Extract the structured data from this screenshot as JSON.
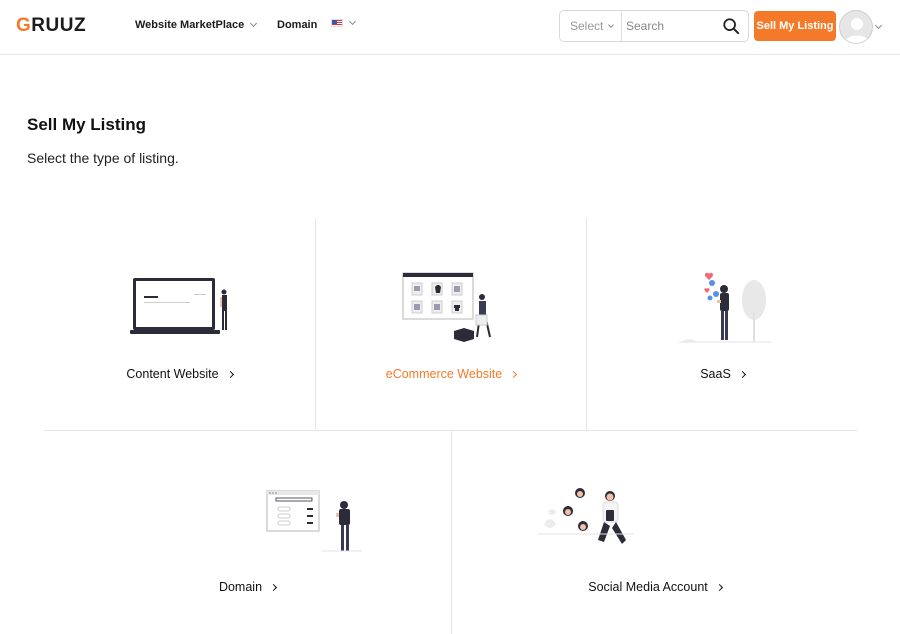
{
  "header": {
    "logo_first": "G",
    "logo_rest": "RUUZ",
    "nav": {
      "market": "Website MarketPlace",
      "domain": "Domain"
    },
    "search": {
      "select_label": "Select",
      "placeholder": "Search"
    },
    "sell_label": "Sell My Listing"
  },
  "main": {
    "title": "Sell My Listing",
    "subtitle": "Select the type of listing.",
    "cards": [
      {
        "label": "Content Website"
      },
      {
        "label": "eCommerce Website"
      },
      {
        "label": "SaaS"
      },
      {
        "label": "Domain"
      },
      {
        "label": "Social Media Account"
      }
    ]
  },
  "colors": {
    "accent": "#f47a2a",
    "text": "#111111",
    "border": "#e6e6e6"
  }
}
